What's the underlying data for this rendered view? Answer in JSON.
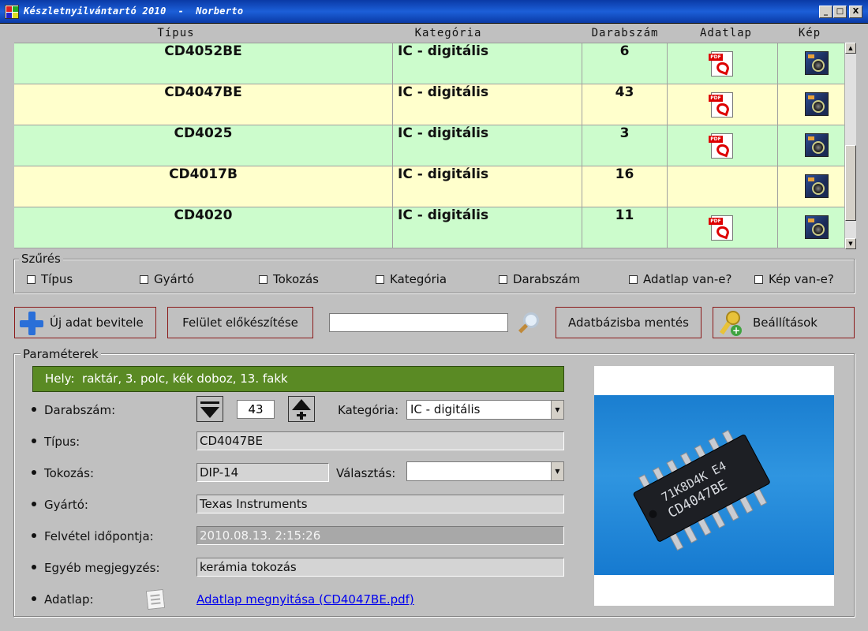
{
  "window": {
    "title": "Készletnyilvántartó 2010  -  Norberto",
    "buttons": {
      "minimize": "_",
      "maximize": "□",
      "close": "X"
    }
  },
  "grid": {
    "columns": [
      "Típus",
      "Kategória",
      "Darabszám",
      "Adatlap",
      "Kép"
    ],
    "rows": [
      {
        "type": "CD4052BE",
        "category": "IC - digitális",
        "count": "6",
        "has_pdf": true,
        "has_image": true
      },
      {
        "type": "CD4047BE",
        "category": "IC - digitális",
        "count": "43",
        "has_pdf": true,
        "has_image": true
      },
      {
        "type": "CD4025",
        "category": "IC - digitális",
        "count": "3",
        "has_pdf": true,
        "has_image": true
      },
      {
        "type": "CD4017B",
        "category": "IC - digitális",
        "count": "16",
        "has_pdf": false,
        "has_image": true
      },
      {
        "type": "CD4020",
        "category": "IC - digitális",
        "count": "11",
        "has_pdf": true,
        "has_image": true
      }
    ],
    "pdf_badge": "PDF",
    "row_colors": {
      "green": "#ccfccc",
      "yellow": "#ffffcc"
    }
  },
  "filter": {
    "title": "Szűrés",
    "options": [
      "Típus",
      "Gyártó",
      "Tokozás",
      "Kategória",
      "Darabszám",
      "Adatlap van-e?",
      "Kép van-e?"
    ]
  },
  "toolbar": {
    "new_entry": "Új adat bevitele",
    "prepare": "Felület előkészítése",
    "search_value": "",
    "save_db": "Adatbázisba mentés",
    "settings": "Beállítások"
  },
  "params": {
    "title": "Paraméterek",
    "location": "Hely:  raktár, 3. polc, kék doboz, 13. fakk",
    "location_color": "#5a8a24",
    "count_label": "Darabszám:",
    "count_value": "43",
    "category_label": "Kategória:",
    "category_value": "IC - digitális",
    "type_label": "Típus:",
    "type_value": "CD4047BE",
    "package_label": "Tokozás:",
    "package_value": "DIP-14",
    "choose_label": "Választás:",
    "choose_value": "",
    "maker_label": "Gyártó:",
    "maker_value": "Texas Instruments",
    "recorded_label": "Felvétel időpontja:",
    "recorded_value": "2010.08.13. 2:15:26",
    "note_label": "Egyéb megjegyzés:",
    "note_value": "kerámia tokozás",
    "datasheet_label": "Adatlap:",
    "datasheet_link": "Adatlap megnyitása (CD4047BE.pdf)",
    "chip_marking_1": "71K8D4K E4",
    "chip_marking_2": "CD4047BE"
  }
}
